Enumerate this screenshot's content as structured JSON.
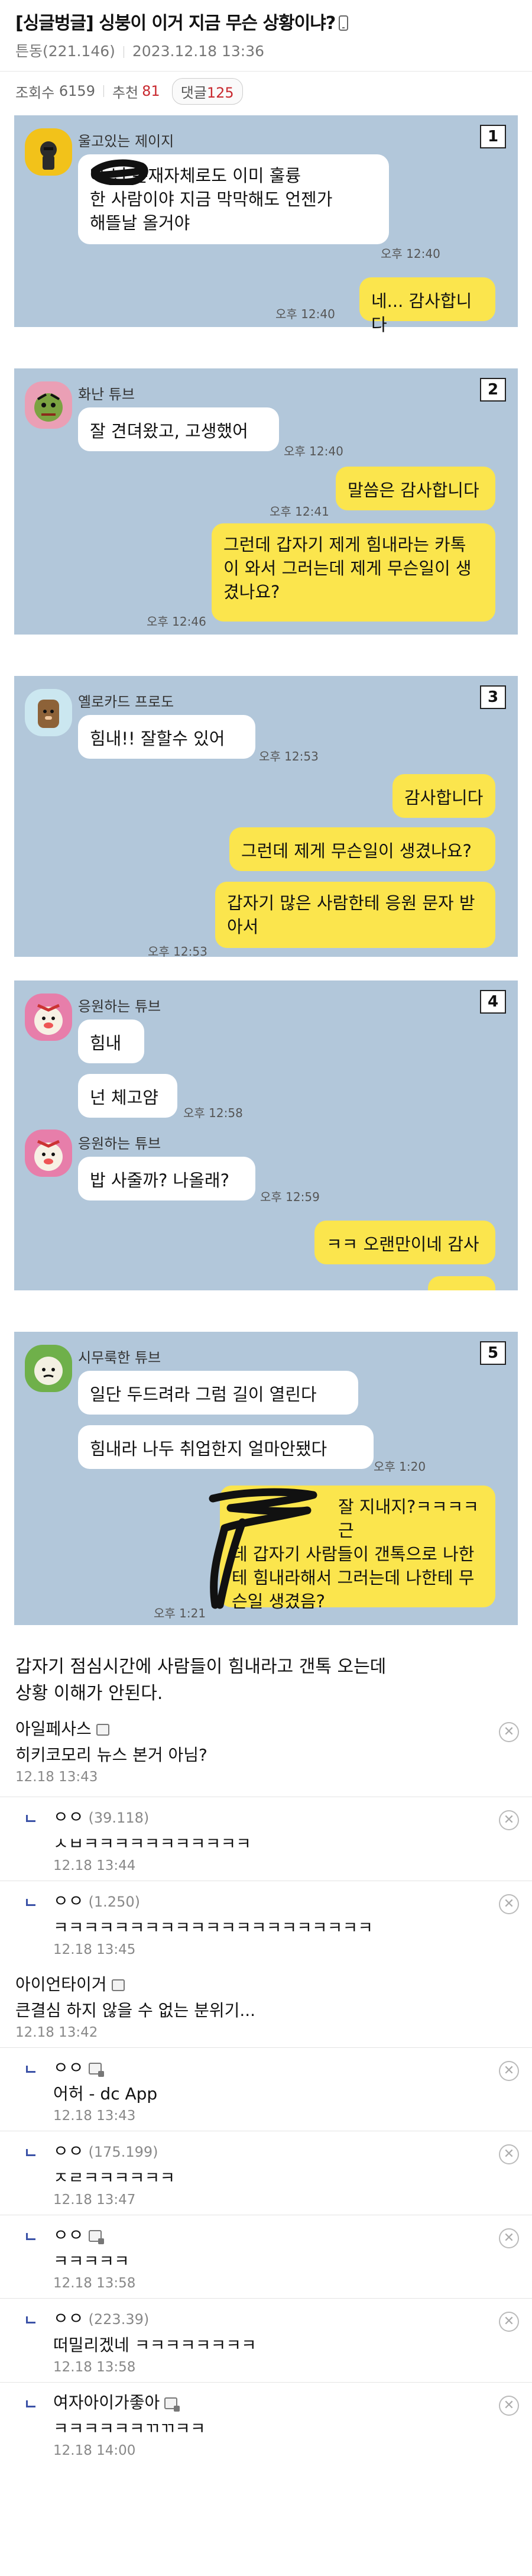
{
  "post": {
    "title": "[싱글벙글] 싱붕이 이거 지금 무슨 상황이냐?",
    "author": "튼동(221.146)",
    "date": "2023.12.18 13:36",
    "views_label": "조회수",
    "views": "6159",
    "rec_label": "추천",
    "rec": "81",
    "comments_label": "댓글",
    "comments": "125"
  },
  "panels": [
    {
      "no": "1",
      "sender": "울고있는 제이지",
      "msgs": [
        {
          "l1": "아 넌 존재자체로도 이미 훌륭",
          "l2": "한 사람이야 지금 막막해도 언젠가",
          "l3": "해뜰날 올거야",
          "time": "오후 12:40"
        },
        {
          "text": "네... 감사합니다",
          "time": "오후 12:40"
        }
      ]
    },
    {
      "no": "2",
      "sender": "화난 튜브",
      "msgs": [
        {
          "text": "잘 견뎌왔고, 고생했어",
          "time": "오후 12:40"
        },
        {
          "text": "말씀은 감사합니다",
          "time": "오후 12:41"
        },
        {
          "l1": "그런데 갑자기 제게 힘내라는 카톡",
          "l2": "이 와서 그러는데 제게 무슨일이 생",
          "l3": "겼나요?",
          "time": "오후 12:46"
        }
      ]
    },
    {
      "no": "3",
      "sender": "옐로카드 프로도",
      "msgs": [
        {
          "text": "힘내!! 잘할수 있어",
          "time": "오후 12:53"
        },
        {
          "text": "감사합니다"
        },
        {
          "text": "그런데 제게 무슨일이 생겼나요?"
        },
        {
          "l1": "갑자기 많은 사람한테 응원 문자 받",
          "l2": "아서",
          "time": "오후 12:53"
        }
      ]
    },
    {
      "no": "4",
      "sender1": "응원하는 튜브",
      "sender2": "응원하는 튜브",
      "msgs": [
        {
          "text": "힘내"
        },
        {
          "text": "넌 체고얌",
          "time": "오후 12:58"
        },
        {
          "text": "밥 사줄까? 나올래?",
          "time": "오후 12:59"
        },
        {
          "text": "ㅋㅋ 오랜만이네 감사"
        }
      ]
    },
    {
      "no": "5",
      "sender": "시무룩한 튜브",
      "msgs": [
        {
          "text": "일단 두드려라 그럼 길이 열린다"
        },
        {
          "text": "힘내라 나두 취업한지 얼마안됐다",
          "time": "오후 1:20"
        },
        {
          "l1": "잘 지내지?ㅋㅋㅋㅋ 근",
          "l2": "데 갑자기 사람들이 갠톡으로 나한",
          "l3": "테 힘내라해서 그러는데 나한테 무",
          "l4": "슨일 생겼음?",
          "time": "오후 1:21"
        }
      ]
    }
  ],
  "body": {
    "line1": "갑자기 점심시간에 사람들이 힘내라고 갠톡 오는데",
    "line2": "상황 이해가 안된다."
  },
  "comments": [
    {
      "name": "아일페사스",
      "ip": "",
      "text": "히키코모리 뉴스 본거 아님?",
      "date": "12.18 13:43",
      "reply": false,
      "icon": true
    },
    {
      "name": "ㅇㅇ",
      "ip": "(39.118)",
      "text": "ㅅㅂㅋㅋㅋㅋㅋㅋㅋㅋㅋㅋㅋ",
      "date": "12.18 13:44",
      "reply": true,
      "icon": false
    },
    {
      "name": "ㅇㅇ",
      "ip": "(1.250)",
      "text": "ㅋㅋㅋㅋㅋㅋㅋㅋㅋㅋㅋㅋㅋㅋㅋㅋㅋㅋㅋㅋㅋ",
      "date": "12.18 13:45",
      "reply": true,
      "icon": false
    },
    {
      "name": "아이언타이거",
      "ip": "",
      "text": "큰결심 하지 않을 수 없는 분위기...",
      "date": "12.18 13:42",
      "reply": false,
      "icon": true
    },
    {
      "name": "ㅇㅇ",
      "ip": "",
      "text": "어허 - dc App",
      "date": "12.18 13:43",
      "reply": true,
      "icon": true
    },
    {
      "name": "ㅇㅇ",
      "ip": "(175.199)",
      "text": "ㅈㄹㅋㅋㅋㅋㅋㅋ",
      "date": "12.18 13:47",
      "reply": true,
      "icon": false
    },
    {
      "name": "ㅇㅇ",
      "ip": "",
      "text": "ㅋㅋㅋㅋㅋ",
      "date": "12.18 13:58",
      "reply": true,
      "icon": true
    },
    {
      "name": "ㅇㅇ",
      "ip": "(223.39)",
      "text": "떠밀리겠네 ㅋㅋㅋㅋㅋㅋㅋㅋ",
      "date": "12.18 13:58",
      "reply": true,
      "icon": false
    },
    {
      "name": "여자아이가좋아",
      "ip": "",
      "text": "ㅋㅋㅋㅋㅋㅋㄲㄲㅋㅋ",
      "date": "12.18 14:00",
      "reply": true,
      "icon": true
    }
  ],
  "colors": {
    "chat_bg": "#b2c7da",
    "bubble_out": "#fbe54d",
    "bubble_in": "#ffffff",
    "accent": "#c8282e"
  },
  "icons": {
    "phone": "phone-icon",
    "close": "close-icon",
    "reply": "reply-arrow-icon",
    "nickname": "fixed-nick-icon"
  }
}
